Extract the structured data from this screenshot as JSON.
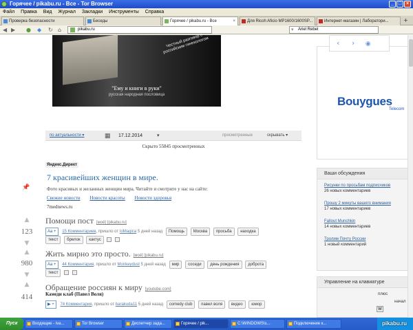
{
  "window": {
    "title": "Горячее / pikabu.ru - Все - Tor Browser"
  },
  "menu": [
    "Файл",
    "Правка",
    "Вид",
    "Журнал",
    "Закладки",
    "Инструменты",
    "Справка"
  ],
  "tabs": [
    {
      "label": "Проверка безопасности",
      "active": false
    },
    {
      "label": "Беседы",
      "active": false
    },
    {
      "label": "Горячее / pikabu.ru - Все",
      "active": true
    },
    {
      "label": "Для Ricoh Aficio MP1600/1600SP...",
      "active": false
    },
    {
      "label": "Интернет-магазин | Лаборатори...",
      "active": false
    }
  ],
  "nav": {
    "url": "pikabu.ru",
    "search_value": "Ariel Rebel"
  },
  "banner": {
    "stamp": "Честный разговор с российским гинекологом",
    "quote": "\"Ему и книги в руки\"",
    "subtitle": "русская народная пословица"
  },
  "filter": {
    "sort": "по актуальности",
    "date": "17.12.2014",
    "viewed": "просмотренные",
    "hide": "скрывать"
  },
  "viewed_note": "Скрыто 55845 просмотренных",
  "ad": {
    "label": "Яндекс.Директ",
    "title": "7 красивейших женщин в мире.",
    "desc": "Фото красивых и желанных женщин мира. Читайте и смотрите у нас на сайте:",
    "links": [
      "Свежие новости",
      "Новости красоты",
      "Новости здоровья"
    ],
    "url": "7mednews.ru"
  },
  "posts": [
    {
      "rating": "123",
      "title": "Помощи пост",
      "src": "[моё] [pikabu.ru]",
      "comments": "15 Комментариев",
      "meta": ", пришло от",
      "author": "IoMagica",
      "time": "5 дней назад",
      "tags": [
        "Помощь",
        "Москва",
        "просьба",
        "находка",
        "текст",
        "брелок",
        "кактус"
      ]
    },
    {
      "rating": "980",
      "title": "Жить мирно это просто.",
      "src": "[моё] [pikabu.ru]",
      "comments": "44 Комментария",
      "meta": ", пришло от",
      "author": "Monkeydust",
      "time": "5 дней назад",
      "tags": [
        "мир",
        "соседи",
        "день рождения",
        "доброта",
        "текст"
      ]
    },
    {
      "rating": "414",
      "title": "Обращение россиян к миру",
      "src": "[youtube.com]",
      "subtitle": "Камеди клаб (Павел Воля)",
      "comments": "74 Комментария",
      "meta": ", пришло от",
      "author": "barakuda11",
      "time": "5 дней назад",
      "tags": [
        "comedy club",
        "павел воля",
        "видео",
        "юмор"
      ]
    }
  ],
  "sidebar": {
    "ad_brand": "Bouygues",
    "ad_sub": "Telecom",
    "discussions_title": "Ваши обсуждения",
    "discussions": [
      {
        "title": "Рисунки по просьбам подписчиков",
        "count": "26 новых комментариев"
      },
      {
        "title": "Прошу 2 минуты вашего внимания",
        "count": "17 новых комментариев"
      },
      {
        "title": "Fallout Munchkin",
        "count": "14 новых комментариев"
      },
      {
        "title": "Тролим Почту России",
        "count": "1 новый комментарий"
      }
    ],
    "keyboard_title": "Управление на клавиатуре",
    "keyboard_plus": "плюс",
    "keyboard_start": "начал",
    "keyboard_key": "W"
  },
  "taskbar": {
    "start": "Пуск",
    "tasks": [
      "Входящие - iva...",
      "Tor Browser",
      "Диспетчер зада...",
      "Горячее / pik...",
      "C:\\WINDOWS\\s...",
      "Подключение к..."
    ]
  },
  "watermark": "pikabu.ru"
}
